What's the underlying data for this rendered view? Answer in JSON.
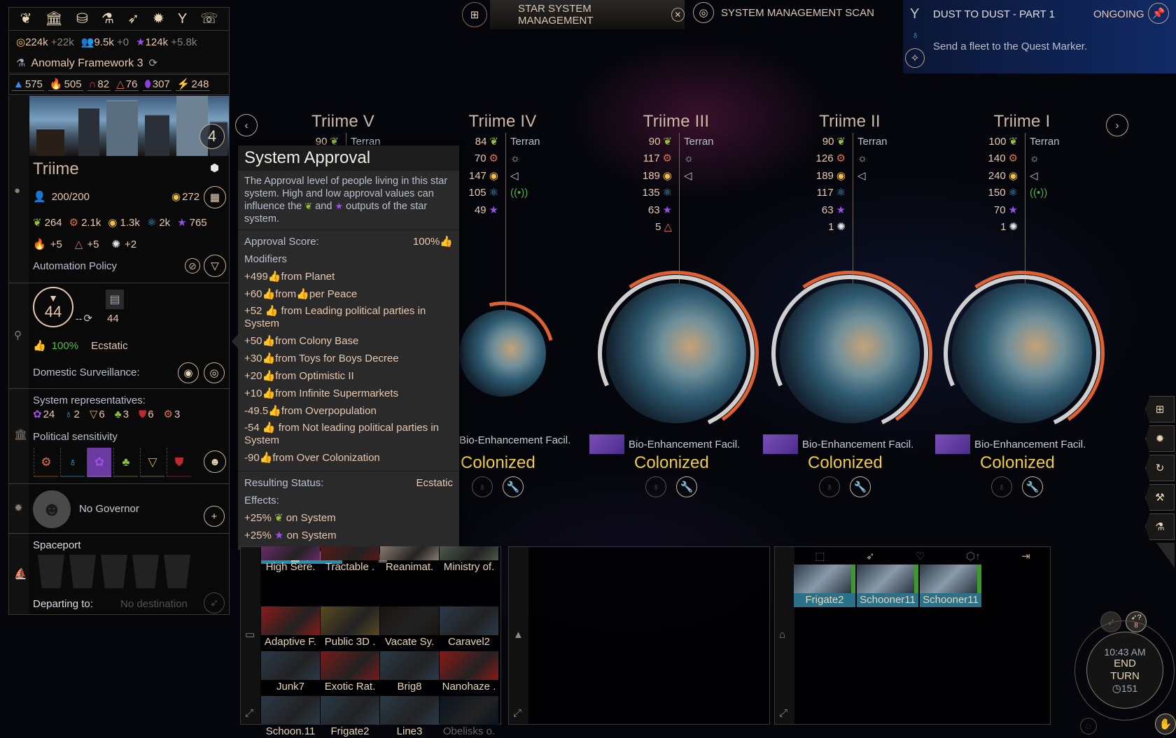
{
  "topbar": {
    "icons": [
      "laurel-icon",
      "senate-icon",
      "coins-icon",
      "research-flask-icon",
      "fleet-ship-icon",
      "badge-icon",
      "trophy-icon",
      "diplomacy-alert-icon"
    ]
  },
  "resources": {
    "dust": {
      "value": "224k",
      "delta": "+22k"
    },
    "population": {
      "value": "9.5k",
      "delta": "+0"
    },
    "influence": {
      "value": "124k",
      "delta": "+5.8k"
    }
  },
  "research": {
    "label": "Anomaly Framework 3"
  },
  "strategic": [
    {
      "icon": "titanium-icon",
      "value": "575",
      "color": "#3a8cf0"
    },
    {
      "icon": "hyperium-icon",
      "value": "505",
      "color": "#f0c048"
    },
    {
      "icon": "adamantian-icon",
      "value": "82",
      "color": "#e0305a"
    },
    {
      "icon": "antimatter-icon",
      "value": "76",
      "color": "#e0705a"
    },
    {
      "icon": "palladium-icon",
      "value": "307",
      "color": "#8a40d8"
    },
    {
      "icon": "auriga-icon",
      "value": "248",
      "color": "#30c050"
    }
  ],
  "system": {
    "level": "4",
    "name": "Triime",
    "population": "200/200",
    "dust_income": "272",
    "yields": [
      {
        "icon": "food-icon",
        "value": "264",
        "color": "#9ac040"
      },
      {
        "icon": "industry-icon",
        "value": "2.1k",
        "color": "#e0704a"
      },
      {
        "icon": "dust-icon",
        "value": "1.3k",
        "color": "#f0c048"
      },
      {
        "icon": "science-icon",
        "value": "2k",
        "color": "#40b0d8"
      },
      {
        "icon": "influence-icon",
        "value": "765",
        "color": "#9a50e8"
      }
    ],
    "strategic_yields": [
      {
        "icon": "hyperium-icon",
        "value": "+5",
        "color": "#f0c048"
      },
      {
        "icon": "antimatter-icon",
        "value": "+5",
        "color": "#e0705a"
      },
      {
        "icon": "orichalcum-icon",
        "value": "+2",
        "color": "#e8e8e8"
      }
    ],
    "automation_label": "Automation Policy",
    "pop_circle": "44",
    "pop_growth": "--",
    "pop_cap": "44",
    "approval_pct": "100%",
    "approval_status": "Ecstatic",
    "surveillance_label": "Domestic Surveillance:",
    "representatives_label": "System representatives:",
    "representatives": [
      {
        "icon": "pacifist-icon",
        "value": "24",
        "color": "#a050e0"
      },
      {
        "icon": "scientist-icon",
        "value": "2",
        "color": "#40b0d8"
      },
      {
        "icon": "religious-icon",
        "value": "6",
        "color": "#d8b040"
      },
      {
        "icon": "ecologist-icon",
        "value": "3",
        "color": "#8ac040"
      },
      {
        "icon": "militarist-icon",
        "value": "6",
        "color": "#c02830"
      },
      {
        "icon": "industrialist-icon",
        "value": "3",
        "color": "#e0704a"
      }
    ],
    "sensitivity_label": "Political sensitivity",
    "sensitivity": [
      {
        "icon": "industrialist-icon",
        "color": "#c0683a",
        "active": false
      },
      {
        "icon": "scientist-icon",
        "color": "#3aa0c0",
        "active": false
      },
      {
        "icon": "pacifist-icon",
        "color": "#b070e8",
        "active": true
      },
      {
        "icon": "ecologist-icon",
        "color": "#70a040",
        "active": false
      },
      {
        "icon": "religious-icon",
        "color": "#a89060",
        "active": false
      },
      {
        "icon": "militarist-icon",
        "color": "#b02028",
        "active": false
      }
    ],
    "governor_label": "No Governor",
    "spaceport_label": "Spaceport",
    "departing_label": "Departing to:",
    "departing_value": "No destination"
  },
  "tabs": {
    "active": "STAR SYSTEM MANAGEMENT",
    "other": "SYSTEM MANAGEMENT SCAN"
  },
  "quest": {
    "title": "DUST TO DUST - PART 1",
    "status": "ONGOING",
    "objective": "Send a fleet to the Quest Marker."
  },
  "tooltip": {
    "title": "System Approval",
    "description_1": "The Approval level of people living in this star system. High and low approval values can influence the",
    "description_and": "and",
    "description_2": "outputs of the star system.",
    "score_label": "Approval Score:",
    "score_value": "100%",
    "modifiers_label": "Modifiers",
    "modifiers": [
      {
        "value": "+499",
        "text": "from Planet"
      },
      {
        "value": "+60",
        "text": "from",
        "text2": "per Peace"
      },
      {
        "value": "+52",
        "text": "from Leading political parties in System"
      },
      {
        "value": "+50",
        "text": "from Colony Base"
      },
      {
        "value": "+30",
        "text": "from Toys for Boys Decree"
      },
      {
        "value": "+20",
        "text": "from Optimistic II"
      },
      {
        "value": "+10",
        "text": "from Infinite Supermarkets"
      },
      {
        "value": "-49.5",
        "text": "from Overpopulation"
      },
      {
        "value": "-54",
        "text": "from Not leading political parties in System"
      },
      {
        "value": "-90",
        "text": "from Over Colonization"
      }
    ],
    "status_label": "Resulting Status:",
    "status_value": "Ecstatic",
    "effects_label": "Effects:",
    "effects": [
      {
        "value": "+25%",
        "icon": "food-icon",
        "text": "on System"
      },
      {
        "value": "+25%",
        "icon": "influence-icon",
        "text": "on System"
      }
    ]
  },
  "planets": [
    {
      "name": "Triime V",
      "type": "Terran",
      "stats": [
        {
          "v": "90",
          "i": "food-icon"
        }
      ],
      "traits": []
    },
    {
      "name": "Triime IV",
      "type": "Terran",
      "stats": [
        {
          "v": "84",
          "i": "food-icon"
        },
        {
          "v": "70",
          "i": "industry-icon"
        },
        {
          "v": "147",
          "i": "dust-icon"
        },
        {
          "v": "105",
          "i": "science-icon"
        },
        {
          "v": "49",
          "i": "influence-icon"
        }
      ],
      "traits": [
        "sun-icon",
        "fish-icon",
        "signal-icon"
      ],
      "improvement": "Bio-Enhancement Facil.",
      "status": "Colonized"
    },
    {
      "name": "Triime III",
      "type": "Terran",
      "stats": [
        {
          "v": "90",
          "i": "food-icon"
        },
        {
          "v": "117",
          "i": "industry-icon"
        },
        {
          "v": "189",
          "i": "dust-icon"
        },
        {
          "v": "135",
          "i": "science-icon"
        },
        {
          "v": "63",
          "i": "influence-icon"
        },
        {
          "v": "5",
          "i": "antimatter-icon"
        }
      ],
      "traits": [
        "sun-icon",
        "fish-icon"
      ],
      "improvement": "Bio-Enhancement Facil.",
      "status": "Colonized"
    },
    {
      "name": "Triime II",
      "type": "Terran",
      "stats": [
        {
          "v": "90",
          "i": "food-icon"
        },
        {
          "v": "126",
          "i": "industry-icon"
        },
        {
          "v": "189",
          "i": "dust-icon"
        },
        {
          "v": "117",
          "i": "science-icon"
        },
        {
          "v": "63",
          "i": "influence-icon"
        },
        {
          "v": "1",
          "i": "orichalcum-icon"
        }
      ],
      "traits": [
        "sun-icon",
        "fish-icon"
      ],
      "improvement": "Bio-Enhancement Facil.",
      "status": "Colonized"
    },
    {
      "name": "Triime I",
      "type": "Terran",
      "stats": [
        {
          "v": "100",
          "i": "food-icon"
        },
        {
          "v": "140",
          "i": "industry-icon"
        },
        {
          "v": "240",
          "i": "dust-icon"
        },
        {
          "v": "150",
          "i": "science-icon"
        },
        {
          "v": "70",
          "i": "influence-icon"
        },
        {
          "v": "1",
          "i": "orichalcum-icon"
        }
      ],
      "traits": [
        "sun-icon",
        "fish-icon",
        "signal-icon"
      ],
      "improvement": "Bio-Enhancement Facil.",
      "status": "Colonized"
    }
  ],
  "build_queue": {
    "items": [
      "High Sere.",
      "Tractable .",
      "Reanimat.",
      "Ministry of.",
      "Adaptive F.",
      "Public 3D .",
      "Vacate Sy.",
      "Caravel2",
      "Junk7",
      "Exotic Rat.",
      "Brig8",
      "Nanohaze .",
      "Schoon.11",
      "Frigate2",
      "Line3",
      "Obelisks o."
    ]
  },
  "fleet": {
    "ships": [
      "Frigate2",
      "Schooner11",
      "Schooner11"
    ]
  },
  "endturn": {
    "time": "10:43 AM",
    "label_1": "END",
    "label_2": "TURN",
    "turn": "151",
    "fleet_count": "8"
  }
}
